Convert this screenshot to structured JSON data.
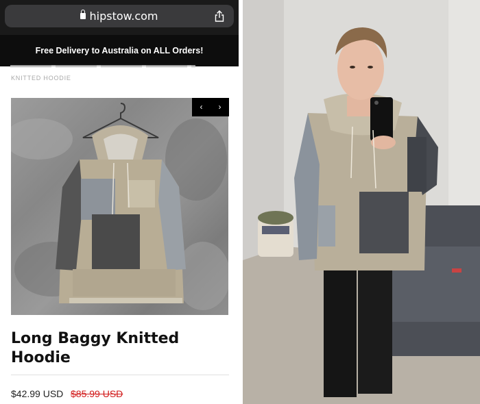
{
  "browser": {
    "url": "hipstow.com"
  },
  "promo": {
    "text": "Free Delivery to Australia on ALL Orders!"
  },
  "breadcrumb": {
    "current": "KNITTED HOODIE"
  },
  "carousel": {
    "prev_label": "‹",
    "next_label": "›"
  },
  "product": {
    "title": "Long Baggy Knitted Hoodie",
    "price": "$42.99 USD",
    "old_price": "$85.99 USD"
  },
  "colors": {
    "promo_bg": "#0d0d0d",
    "sale_red": "#d11a1a",
    "browser_bg": "#1a1a1a"
  }
}
